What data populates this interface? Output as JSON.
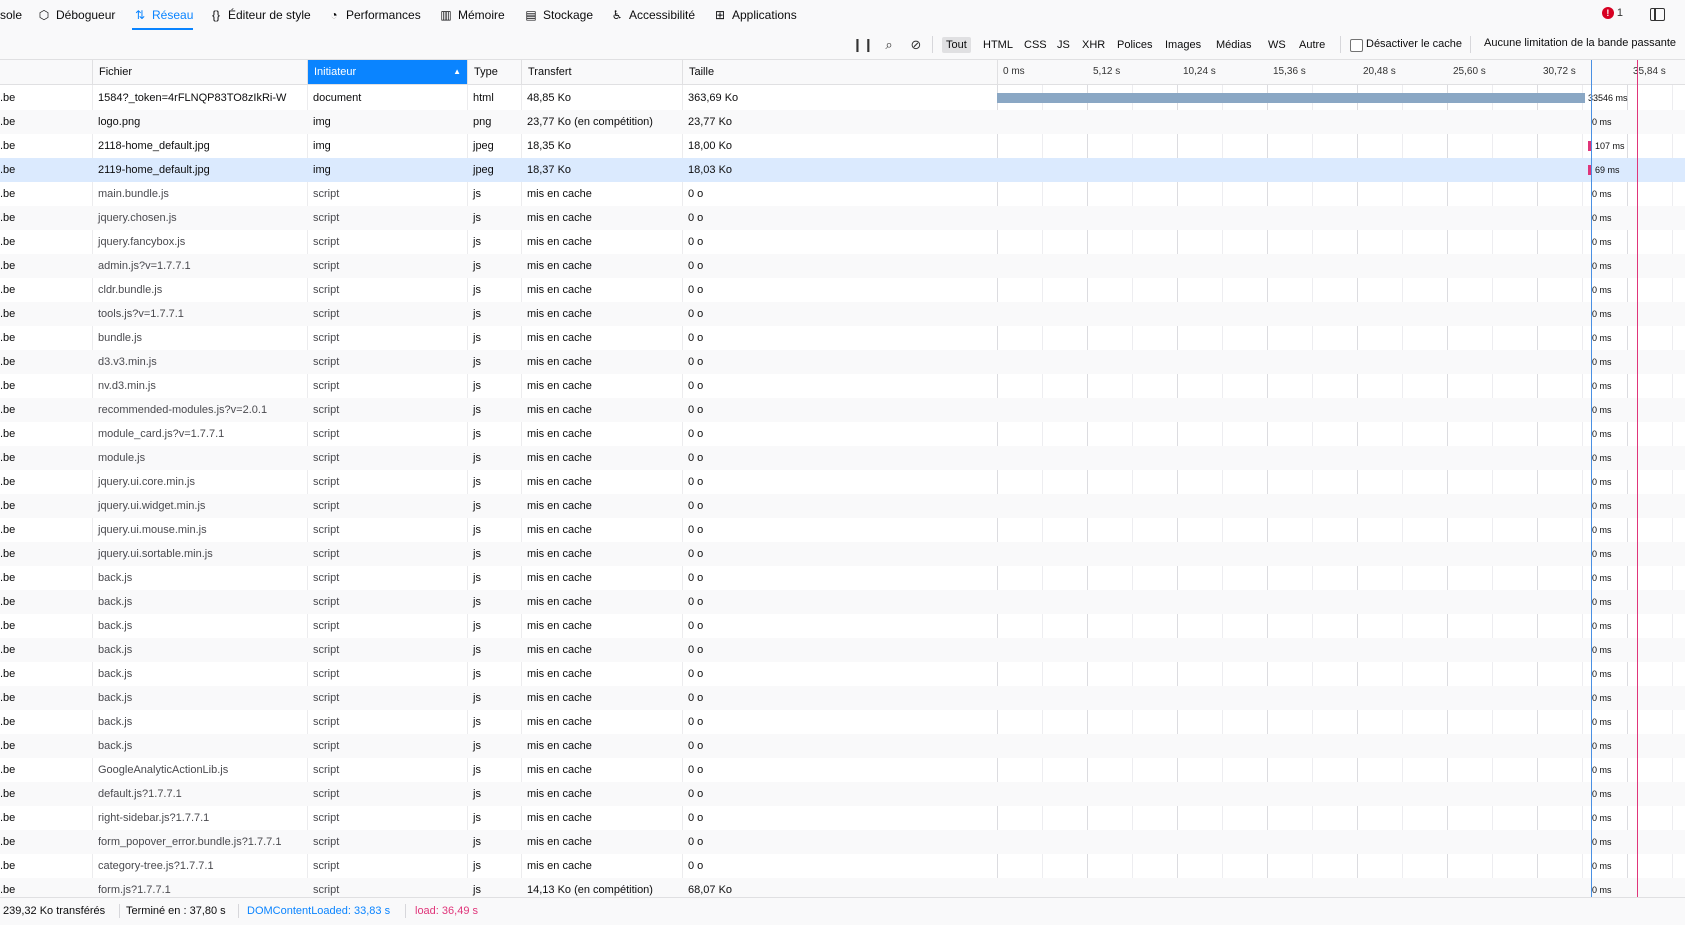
{
  "tabs": [
    {
      "label": "sole",
      "icon": "console-icon"
    },
    {
      "label": "Débogueur",
      "icon": "debugger-icon"
    },
    {
      "label": "Réseau",
      "icon": "network-icon"
    },
    {
      "label": "Éditeur de style",
      "icon": "style-editor-icon"
    },
    {
      "label": "Performances",
      "icon": "performance-icon"
    },
    {
      "label": "Mémoire",
      "icon": "memory-icon"
    },
    {
      "label": "Stockage",
      "icon": "storage-icon"
    },
    {
      "label": "Accessibilité",
      "icon": "accessibility-icon"
    },
    {
      "label": "Applications",
      "icon": "applications-icon"
    }
  ],
  "active_tab": "Réseau",
  "error_count": "1",
  "toolbar": {
    "filter_types": [
      "Tout",
      "HTML",
      "CSS",
      "JS",
      "XHR",
      "Polices",
      "Images",
      "Médias",
      "WS",
      "Autre"
    ],
    "active_filter": "Tout",
    "disable_cache_label": "Désactiver le cache",
    "throttling_label": "Aucune limitation de la bande passante"
  },
  "columns": {
    "domain": "",
    "file": "Fichier",
    "initiator": "Initiateur",
    "type": "Type",
    "transfer": "Transfert",
    "size": "Taille"
  },
  "timeline_ticks": [
    "0 ms",
    "5,12 s",
    "10,24 s",
    "15,36 s",
    "20,48 s",
    "25,60 s",
    "30,72 s",
    "35,84 s"
  ],
  "requests": [
    {
      "domain": ".be",
      "file": "1584?_token=4rFLNQP83TO8zIkRi-W",
      "initiator": "document",
      "type": "html",
      "transfer": "48,85 Ko",
      "size": "363,69 Ko",
      "timing": "33546 ms"
    },
    {
      "domain": ".be",
      "file": "logo.png",
      "initiator": "img",
      "type": "png",
      "transfer": "23,77 Ko (en compétition)",
      "size": "23,77 Ko",
      "timing": "0 ms"
    },
    {
      "domain": ".be",
      "file": "2118-home_default.jpg",
      "initiator": "img",
      "type": "jpeg",
      "transfer": "18,35 Ko",
      "size": "18,00 Ko",
      "timing": "107 ms"
    },
    {
      "domain": ".be",
      "file": "2119-home_default.jpg",
      "initiator": "img",
      "type": "jpeg",
      "transfer": "18,37 Ko",
      "size": "18,03 Ko",
      "timing": "69 ms"
    },
    {
      "domain": ".be",
      "file": "main.bundle.js",
      "initiator": "script",
      "type": "js",
      "transfer": "mis en cache",
      "size": "0 o",
      "timing": "0 ms"
    },
    {
      "domain": ".be",
      "file": "jquery.chosen.js",
      "initiator": "script",
      "type": "js",
      "transfer": "mis en cache",
      "size": "0 o",
      "timing": "0 ms"
    },
    {
      "domain": ".be",
      "file": "jquery.fancybox.js",
      "initiator": "script",
      "type": "js",
      "transfer": "mis en cache",
      "size": "0 o",
      "timing": "0 ms"
    },
    {
      "domain": ".be",
      "file": "admin.js?v=1.7.7.1",
      "initiator": "script",
      "type": "js",
      "transfer": "mis en cache",
      "size": "0 o",
      "timing": "0 ms"
    },
    {
      "domain": ".be",
      "file": "cldr.bundle.js",
      "initiator": "script",
      "type": "js",
      "transfer": "mis en cache",
      "size": "0 o",
      "timing": "0 ms"
    },
    {
      "domain": ".be",
      "file": "tools.js?v=1.7.7.1",
      "initiator": "script",
      "type": "js",
      "transfer": "mis en cache",
      "size": "0 o",
      "timing": "0 ms"
    },
    {
      "domain": ".be",
      "file": "bundle.js",
      "initiator": "script",
      "type": "js",
      "transfer": "mis en cache",
      "size": "0 o",
      "timing": "0 ms"
    },
    {
      "domain": ".be",
      "file": "d3.v3.min.js",
      "initiator": "script",
      "type": "js",
      "transfer": "mis en cache",
      "size": "0 o",
      "timing": "0 ms"
    },
    {
      "domain": ".be",
      "file": "nv.d3.min.js",
      "initiator": "script",
      "type": "js",
      "transfer": "mis en cache",
      "size": "0 o",
      "timing": "0 ms"
    },
    {
      "domain": ".be",
      "file": "recommended-modules.js?v=2.0.1",
      "initiator": "script",
      "type": "js",
      "transfer": "mis en cache",
      "size": "0 o",
      "timing": "0 ms"
    },
    {
      "domain": ".be",
      "file": "module_card.js?v=1.7.7.1",
      "initiator": "script",
      "type": "js",
      "transfer": "mis en cache",
      "size": "0 o",
      "timing": "0 ms"
    },
    {
      "domain": ".be",
      "file": "module.js",
      "initiator": "script",
      "type": "js",
      "transfer": "mis en cache",
      "size": "0 o",
      "timing": "0 ms"
    },
    {
      "domain": ".be",
      "file": "jquery.ui.core.min.js",
      "initiator": "script",
      "type": "js",
      "transfer": "mis en cache",
      "size": "0 o",
      "timing": "0 ms"
    },
    {
      "domain": ".be",
      "file": "jquery.ui.widget.min.js",
      "initiator": "script",
      "type": "js",
      "transfer": "mis en cache",
      "size": "0 o",
      "timing": "0 ms"
    },
    {
      "domain": ".be",
      "file": "jquery.ui.mouse.min.js",
      "initiator": "script",
      "type": "js",
      "transfer": "mis en cache",
      "size": "0 o",
      "timing": "0 ms"
    },
    {
      "domain": ".be",
      "file": "jquery.ui.sortable.min.js",
      "initiator": "script",
      "type": "js",
      "transfer": "mis en cache",
      "size": "0 o",
      "timing": "0 ms"
    },
    {
      "domain": ".be",
      "file": "back.js",
      "initiator": "script",
      "type": "js",
      "transfer": "mis en cache",
      "size": "0 o",
      "timing": "0 ms"
    },
    {
      "domain": ".be",
      "file": "back.js",
      "initiator": "script",
      "type": "js",
      "transfer": "mis en cache",
      "size": "0 o",
      "timing": "0 ms"
    },
    {
      "domain": ".be",
      "file": "back.js",
      "initiator": "script",
      "type": "js",
      "transfer": "mis en cache",
      "size": "0 o",
      "timing": "0 ms"
    },
    {
      "domain": ".be",
      "file": "back.js",
      "initiator": "script",
      "type": "js",
      "transfer": "mis en cache",
      "size": "0 o",
      "timing": "0 ms"
    },
    {
      "domain": ".be",
      "file": "back.js",
      "initiator": "script",
      "type": "js",
      "transfer": "mis en cache",
      "size": "0 o",
      "timing": "0 ms"
    },
    {
      "domain": ".be",
      "file": "back.js",
      "initiator": "script",
      "type": "js",
      "transfer": "mis en cache",
      "size": "0 o",
      "timing": "0 ms"
    },
    {
      "domain": ".be",
      "file": "back.js",
      "initiator": "script",
      "type": "js",
      "transfer": "mis en cache",
      "size": "0 o",
      "timing": "0 ms"
    },
    {
      "domain": ".be",
      "file": "back.js",
      "initiator": "script",
      "type": "js",
      "transfer": "mis en cache",
      "size": "0 o",
      "timing": "0 ms"
    },
    {
      "domain": ".be",
      "file": "GoogleAnalyticActionLib.js",
      "initiator": "script",
      "type": "js",
      "transfer": "mis en cache",
      "size": "0 o",
      "timing": "0 ms"
    },
    {
      "domain": ".be",
      "file": "default.js?1.7.7.1",
      "initiator": "script",
      "type": "js",
      "transfer": "mis en cache",
      "size": "0 o",
      "timing": "0 ms"
    },
    {
      "domain": ".be",
      "file": "right-sidebar.js?1.7.7.1",
      "initiator": "script",
      "type": "js",
      "transfer": "mis en cache",
      "size": "0 o",
      "timing": "0 ms"
    },
    {
      "domain": ".be",
      "file": "form_popover_error.bundle.js?1.7.7.1",
      "initiator": "script",
      "type": "js",
      "transfer": "mis en cache",
      "size": "0 o",
      "timing": "0 ms"
    },
    {
      "domain": ".be",
      "file": "category-tree.js?1.7.7.1",
      "initiator": "script",
      "type": "js",
      "transfer": "mis en cache",
      "size": "0 o",
      "timing": "0 ms"
    },
    {
      "domain": ".be",
      "file": "form.js?1.7.7.1",
      "initiator": "script",
      "type": "js",
      "transfer": "14,13 Ko (en compétition)",
      "size": "68,07 Ko",
      "timing": "0 ms"
    }
  ],
  "selected_row": 3,
  "status": {
    "transferred": "239,32 Ko transférés",
    "finished": "Terminé en : 37,80 s",
    "dom_content_loaded": "DOMContentLoaded: 33,83 s",
    "load": "load: 36,49 s"
  },
  "colors": {
    "accent": "#0a84ff",
    "dom_line": "#4a90e2",
    "load_line": "#e0357a",
    "waterfall_bar": "#8aa7c4",
    "status_blue": "#0a84ff",
    "status_pink": "#e0357a"
  }
}
